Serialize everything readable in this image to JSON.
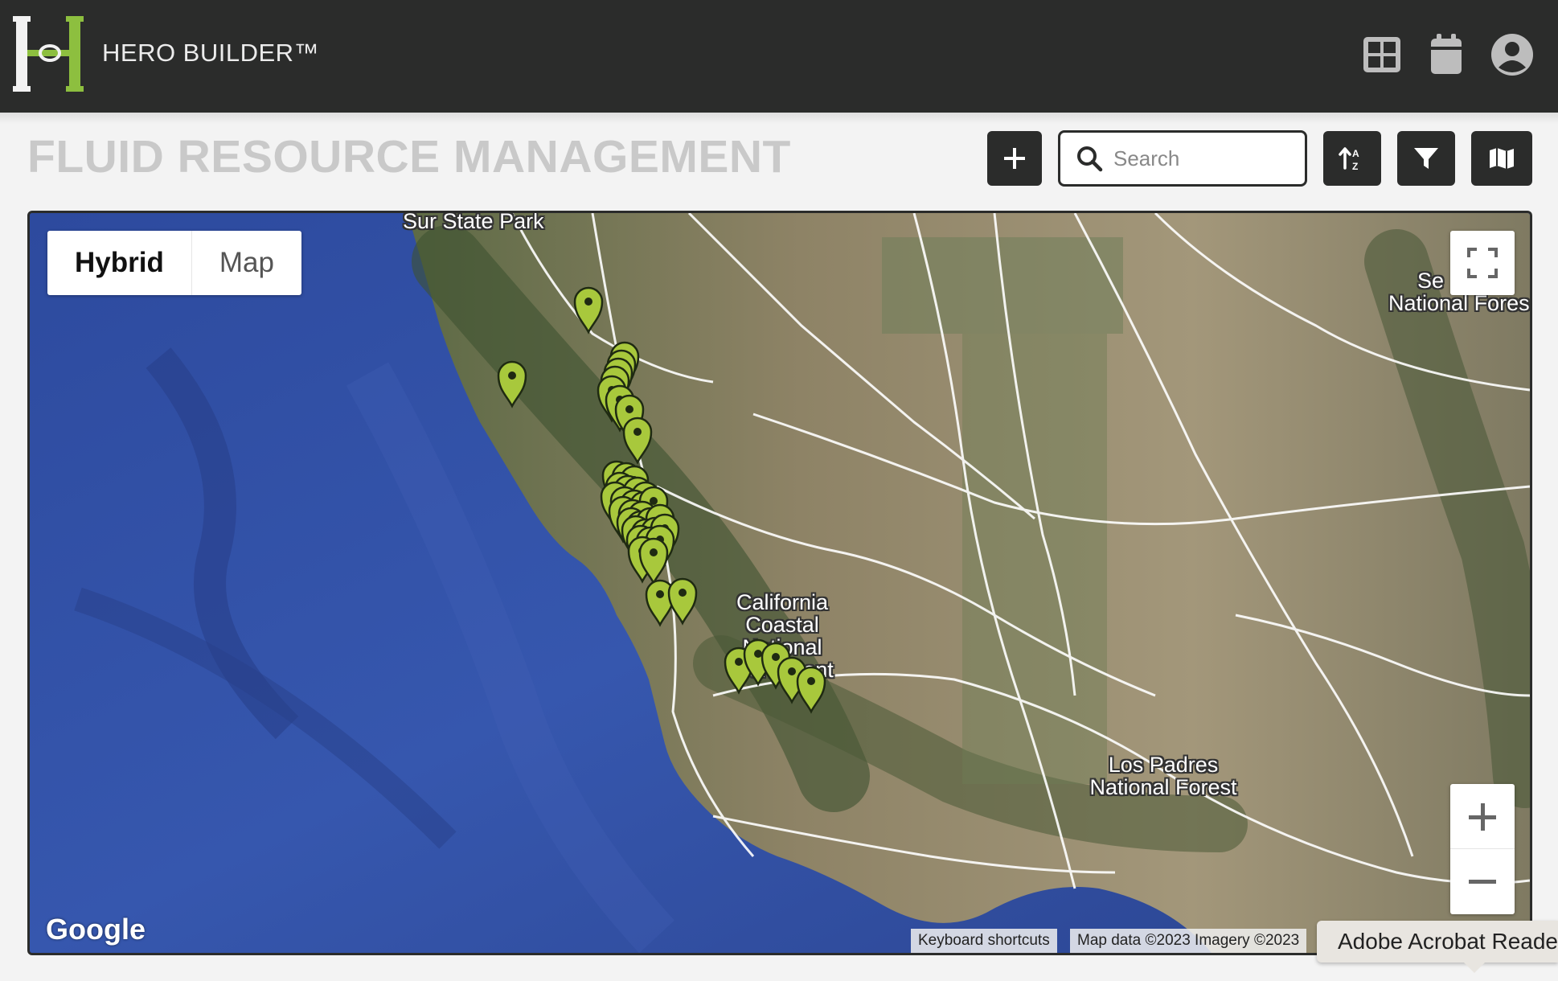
{
  "app": {
    "brand": "HERO BUILDER™",
    "logo_letter": "H"
  },
  "topbar": {
    "icons": [
      "grid-icon",
      "calendar-icon",
      "account-icon"
    ]
  },
  "page": {
    "title": "FLUID RESOURCE MANAGEMENT"
  },
  "toolbar": {
    "add_icon": "plus-icon",
    "search_placeholder": "Search",
    "search_value": "",
    "sort_icon": "sort-icon",
    "filter_icon": "filter-icon",
    "map_view_icon": "map-icon"
  },
  "map": {
    "type_options": [
      "Hybrid",
      "Map"
    ],
    "selected_type": "Hybrid",
    "labels": {
      "park": "Sur State Park",
      "monument": [
        "California",
        "Coastal",
        "National",
        "Monument"
      ],
      "los_padres": [
        "Los Padres",
        "National Forest"
      ],
      "sequoia": [
        "Se",
        "National Fores"
      ]
    },
    "marker_color": "#a8c83c",
    "logo": "Google",
    "attribution": {
      "shortcuts": "Keyboard shortcuts",
      "data": "Map data ©2023 Imagery ©2023"
    },
    "controls": [
      "fullscreen-icon",
      "zoom-in-icon",
      "zoom-out-icon"
    ]
  },
  "tooltip": {
    "text": "Adobe Acrobat Reader"
  },
  "colors": {
    "topbar": "#2b2c2b",
    "accent_green": "#8dbf3f",
    "title_gray": "#c9c9c9"
  }
}
